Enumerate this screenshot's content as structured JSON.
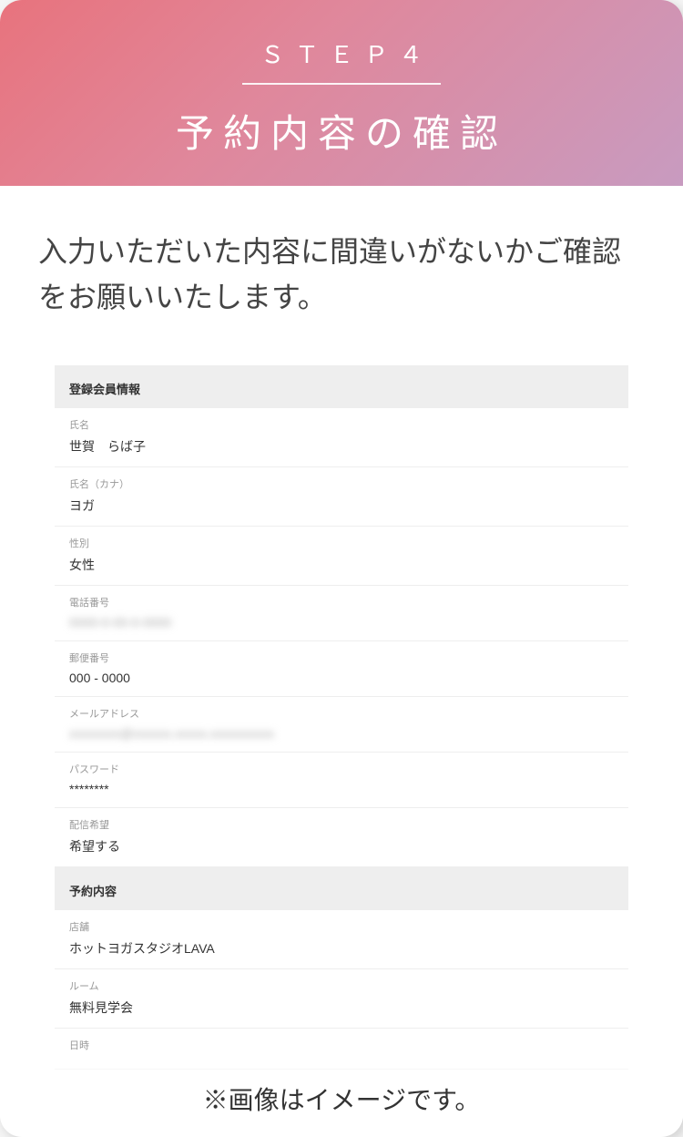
{
  "header": {
    "step": "ＳＴＥＰ４",
    "title": "予約内容の確認"
  },
  "description": "入力いただいた内容に間違いがないかご確認をお願いいたします。",
  "sections": {
    "member": {
      "title": "登録会員情報",
      "name": {
        "label": "氏名",
        "value": "世賀　らば子"
      },
      "kana": {
        "label": "氏名（カナ）",
        "value": "ヨガ"
      },
      "gender": {
        "label": "性別",
        "value": "女性"
      },
      "phone": {
        "label": "電話番号",
        "value": "0000-0-00-0-0000"
      },
      "postal": {
        "label": "郵便番号",
        "value": "000 - 0000"
      },
      "email": {
        "label": "メールアドレス",
        "value": "xxxxxxxx@xxxxxx.xxxxx.xxxxxxxxxx"
      },
      "password": {
        "label": "パスワード",
        "value": "********"
      },
      "subscribe": {
        "label": "配信希望",
        "value": "希望する"
      }
    },
    "reservation": {
      "title": "予約内容",
      "store": {
        "label": "店舗",
        "value": "ホットヨガスタジオLAVA"
      },
      "room": {
        "label": "ルーム",
        "value": "無料見学会"
      },
      "date": {
        "label": "日時",
        "value": ""
      }
    }
  },
  "footer_note": "※画像はイメージです。"
}
